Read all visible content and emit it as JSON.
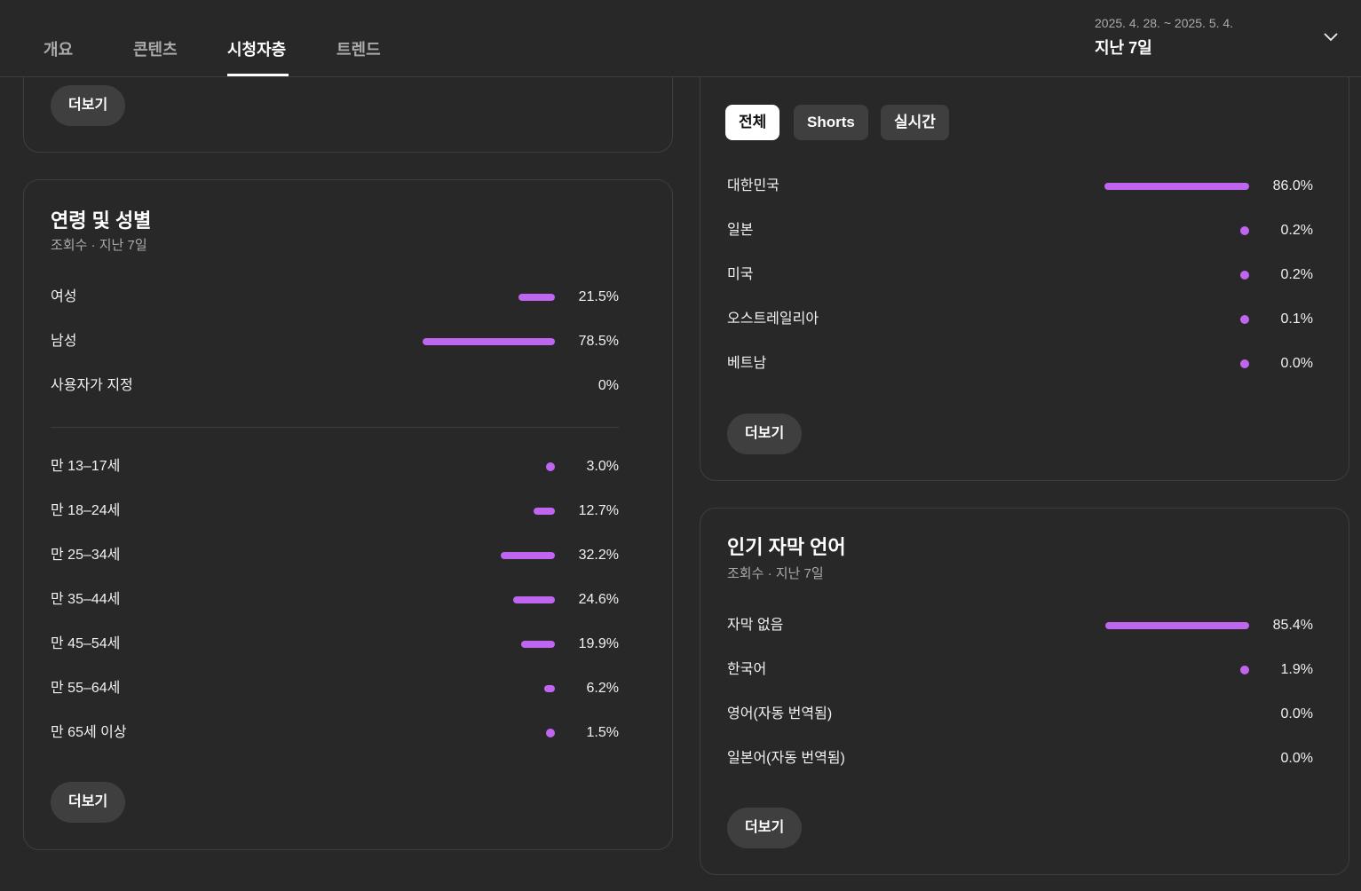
{
  "tabs": [
    "개요",
    "콘텐츠",
    "시청자층",
    "트렌드"
  ],
  "active_tab": "시청자층",
  "date_range": "2025. 4. 28. ~ 2025. 5. 4.",
  "period_label": "지난 7일",
  "accent_color": "#c065f0",
  "more_label": "더보기",
  "age_gender": {
    "title": "연령 및 성별",
    "subtitle": "조회수 · 지난 7일",
    "gender": [
      {
        "label": "여성",
        "value": "21.5%",
        "pct": 21.5
      },
      {
        "label": "남성",
        "value": "78.5%",
        "pct": 78.5
      },
      {
        "label": "사용자가 지정",
        "value": "0%",
        "pct": 0
      }
    ],
    "age": [
      {
        "label": "만 13–17세",
        "value": "3.0%",
        "pct": 3.0
      },
      {
        "label": "만 18–24세",
        "value": "12.7%",
        "pct": 12.7
      },
      {
        "label": "만 25–34세",
        "value": "32.2%",
        "pct": 32.2
      },
      {
        "label": "만 35–44세",
        "value": "24.6%",
        "pct": 24.6
      },
      {
        "label": "만 45–54세",
        "value": "19.9%",
        "pct": 19.9
      },
      {
        "label": "만 55–64세",
        "value": "6.2%",
        "pct": 6.2
      },
      {
        "label": "만 65세 이상",
        "value": "1.5%",
        "pct": 1.5
      }
    ]
  },
  "geography": {
    "filters": [
      "전체",
      "Shorts",
      "실시간"
    ],
    "selected_filter": "전체",
    "rows": [
      {
        "label": "대한민국",
        "value": "86.0%",
        "pct": 86.0
      },
      {
        "label": "일본",
        "value": "0.2%",
        "pct": 0.2
      },
      {
        "label": "미국",
        "value": "0.2%",
        "pct": 0.2
      },
      {
        "label": "오스트레일리아",
        "value": "0.1%",
        "pct": 0.1
      },
      {
        "label": "베트남",
        "value": "0.0%",
        "pct": 0.0
      }
    ]
  },
  "subtitles": {
    "title": "인기 자막 언어",
    "subtitle": "조회수 · 지난 7일",
    "rows": [
      {
        "label": "자막 없음",
        "value": "85.4%",
        "pct": 85.4
      },
      {
        "label": "한국어",
        "value": "1.9%",
        "pct": 1.9
      },
      {
        "label": "영어(자동 번역됨)",
        "value": "0.0%",
        "pct": null
      },
      {
        "label": "일본어(자동 번역됨)",
        "value": "0.0%",
        "pct": null
      }
    ]
  }
}
